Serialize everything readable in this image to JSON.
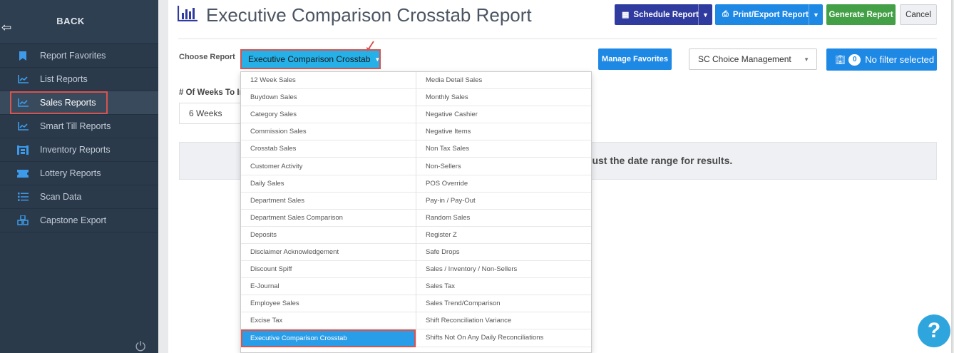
{
  "sidebar": {
    "back_label": "BACK",
    "items": [
      {
        "label": "Report Favorites",
        "icon": "bookmark-icon"
      },
      {
        "label": "List Reports",
        "icon": "chart-line-icon"
      },
      {
        "label": "Sales Reports",
        "icon": "chart-line-icon"
      },
      {
        "label": "Smart Till Reports",
        "icon": "chart-line-icon"
      },
      {
        "label": "Inventory Reports",
        "icon": "warehouse-icon"
      },
      {
        "label": "Lottery Reports",
        "icon": "ticket-icon"
      },
      {
        "label": "Scan Data",
        "icon": "list-icon"
      },
      {
        "label": "Capstone Export",
        "icon": "cubes-icon"
      }
    ],
    "active_item": "Sales Reports"
  },
  "header": {
    "title": "Executive Comparison Crosstab Report",
    "buttons": {
      "schedule": "Schedule Report",
      "print": "Print/Export Report",
      "generate": "Generate Report",
      "cancel": "Cancel"
    }
  },
  "filters": {
    "choose_report_label": "Choose Report",
    "selected_report": "Executive Comparison Crosstab",
    "manage_favorites": "Manage Favorites",
    "store_selected": "SC Choice Management",
    "filter_count": "0",
    "filter_label": "No filter selected",
    "weeks_label": "# Of Weeks To In",
    "weeks_value": "6 Weeks"
  },
  "info_message": "djust the date range for results.",
  "report_options": {
    "column1": [
      "12 Week Sales",
      "Buydown Sales",
      "Category Sales",
      "Commission Sales",
      "Crosstab Sales",
      "Customer Activity",
      "Daily Sales",
      "Department Sales",
      "Department Sales Comparison",
      "Deposits",
      "Disclaimer Acknowledgement",
      "Discount Spiff",
      "E-Journal",
      "Employee Sales",
      "Excise Tax",
      "Executive Comparison Crosstab"
    ],
    "column2": [
      "Media Detail Sales",
      "Monthly Sales",
      "Negative Cashier",
      "Negative Items",
      "Non Tax Sales",
      "Non-Sellers",
      "POS Override",
      "Pay-in / Pay-Out",
      "Random Sales",
      "Register Z",
      "Safe Drops",
      "Sales / Inventory / Non-Sellers",
      "Sales Tax",
      "Sales Trend/Comparison",
      "Shift Reconciliation Variance",
      "Shifts Not On Any Daily Reconciliations"
    ]
  },
  "help_label": "?",
  "colors": {
    "sidebar_bg": "#2b3a4b",
    "schedule_btn": "#2f3b9e",
    "primary_btn": "#1e88e5",
    "generate_btn": "#43a047",
    "highlight": "#d9534f",
    "dropdown_active": "#26b0e8"
  }
}
